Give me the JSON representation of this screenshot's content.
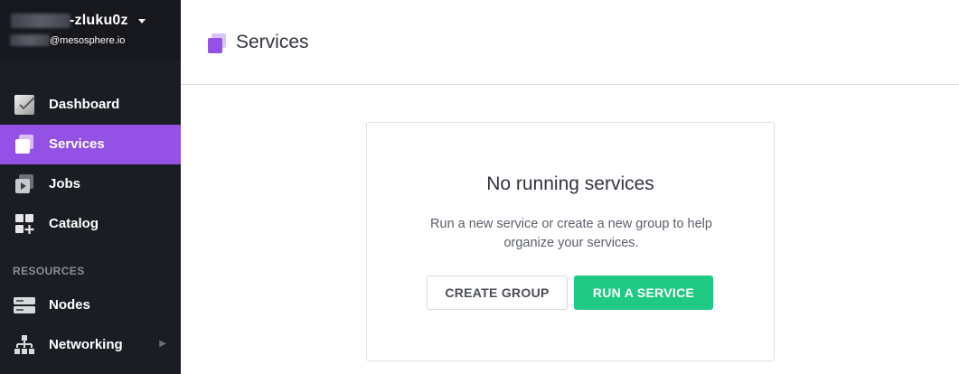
{
  "sidebar": {
    "user": {
      "name_suffix": "-zluku0z",
      "email_suffix": "@mesosphere.io"
    },
    "nav_primary": [
      {
        "label": "Dashboard",
        "icon": "dashboard-icon",
        "active": false
      },
      {
        "label": "Services",
        "icon": "services-icon",
        "active": true
      },
      {
        "label": "Jobs",
        "icon": "jobs-icon",
        "active": false
      },
      {
        "label": "Catalog",
        "icon": "catalog-icon",
        "active": false
      }
    ],
    "section_label": "RESOURCES",
    "nav_resources": [
      {
        "label": "Nodes",
        "icon": "nodes-icon"
      },
      {
        "label": "Networking",
        "icon": "networking-icon",
        "has_submenu": true
      }
    ]
  },
  "header": {
    "title": "Services"
  },
  "empty_state": {
    "title": "No running services",
    "description": "Run a new service or create a new group to help organize your services.",
    "secondary_button": "CREATE GROUP",
    "primary_button": "RUN A SERVICE"
  },
  "colors": {
    "sidebar_bg": "#1b1d24",
    "accent_purple": "#9351e5",
    "primary_green": "#1fca84",
    "text_dark": "#32353e"
  }
}
